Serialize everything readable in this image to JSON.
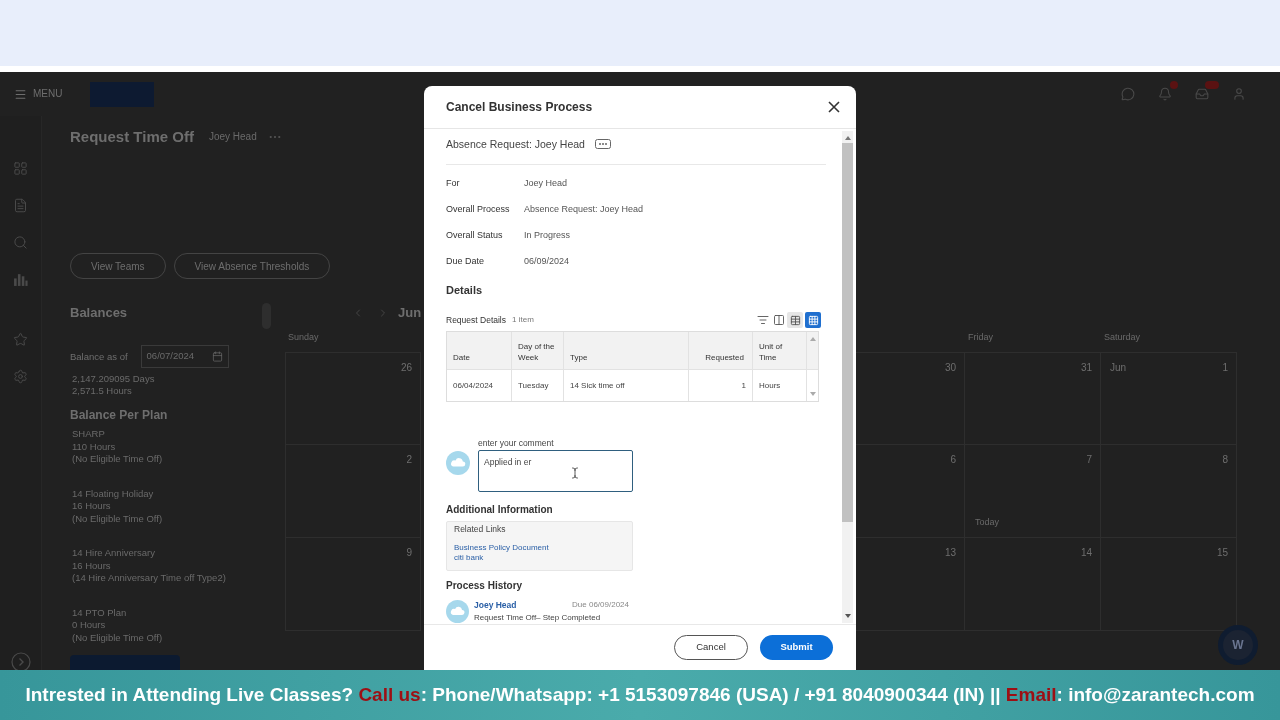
{
  "app_header": {
    "menu_label": "MENU"
  },
  "page": {
    "title": "Request Time Off",
    "worker": "Joey Head",
    "actions": [
      "View Teams",
      "View Absence Thresholds"
    ]
  },
  "balances": {
    "heading": "Balances",
    "as_of_label": "Balance as of",
    "as_of_date": "06/07/2024",
    "totals": [
      "2,147.209095 Days",
      "2,571.5 Hours"
    ],
    "per_plan_heading": "Balance Per Plan",
    "plans": [
      {
        "name": "SHARP",
        "balance": "110 Hours",
        "note": "(No Eligible Time Off)"
      },
      {
        "name": "14 Floating Holiday",
        "balance": "16 Hours",
        "note": "(No Eligible Time Off)"
      },
      {
        "name": "14 Hire Anniversary",
        "balance": "16 Hours",
        "note": "(14 Hire Anniversary Time off Type2)"
      },
      {
        "name": "14 PTO Plan",
        "balance": "0 Hours",
        "note": "(No Eligible Time Off)"
      }
    ]
  },
  "calendar": {
    "month": "Jun",
    "columns": [
      {
        "heading": "Sunday",
        "cells": [
          {
            "date": "26"
          },
          {
            "date": "2"
          },
          {
            "date": "9"
          }
        ]
      },
      {
        "cells": [
          {
            "date": "30"
          },
          {
            "date": "6"
          },
          {
            "date": "13"
          }
        ]
      },
      {
        "heading": "Friday",
        "cells": [
          {
            "date": "31"
          },
          {
            "date": "7",
            "note": "Today"
          },
          {
            "date": "14"
          }
        ]
      },
      {
        "heading": "Saturday",
        "cells": [
          {
            "date": "1",
            "month": "Jun"
          },
          {
            "date": "8"
          },
          {
            "date": "15"
          }
        ]
      }
    ]
  },
  "assistant_button": {
    "label": "W"
  },
  "dialog": {
    "title": "Cancel Business Process",
    "subject": "Absence Request: Joey Head",
    "fields": [
      {
        "label": "For",
        "value": "Joey Head"
      },
      {
        "label": "Overall Process",
        "value": "Absence Request: Joey Head"
      },
      {
        "label": "Overall Status",
        "value": "In Progress"
      },
      {
        "label": "Due Date",
        "value": "06/09/2024"
      }
    ],
    "details_heading": "Details",
    "request_details": {
      "title": "Request Details",
      "count": "1 item",
      "view_modes": [
        {
          "kind": "table",
          "selected": false
        },
        {
          "kind": "grid",
          "selected": true
        }
      ],
      "columns": [
        {
          "label": "Date",
          "kind": "text"
        },
        {
          "label": "Day of the Week",
          "kind": "text"
        },
        {
          "label": "Type",
          "kind": "text"
        },
        {
          "label": "Requested",
          "kind": "number"
        },
        {
          "label": "Unit of Time",
          "kind": "text"
        }
      ],
      "rows": [
        [
          "06/04/2024",
          "Tuesday",
          "14 Sick time off",
          "1",
          "Hours"
        ]
      ]
    },
    "comment": {
      "label": "enter your comment",
      "value": "Applied in er"
    },
    "additional_information": {
      "heading": "Additional Information",
      "related_links_heading": "Related Links",
      "links": [
        "Business Policy Document",
        "citi bank"
      ]
    },
    "process_history": {
      "heading": "Process History",
      "entries": [
        {
          "name": "Joey Head",
          "due": "Due 06/09/2024",
          "step": "Request Time Off– Step Completed"
        }
      ]
    },
    "buttons": [
      {
        "label": "Cancel",
        "kind": "secondary"
      },
      {
        "label": "Submit",
        "kind": "primary"
      }
    ]
  },
  "banner": {
    "segments": [
      {
        "text": "Intrested in Attending Live Classes? ",
        "kind": "plain"
      },
      {
        "text": "Call us",
        "kind": "highlight"
      },
      {
        "text": ": Phone/Whatsapp: +1 5153097846 (USA) / +91 8040900344 (IN) || ",
        "kind": "plain"
      },
      {
        "text": "Email",
        "kind": "highlight"
      },
      {
        "text": ": info@zarantech.com",
        "kind": "plain"
      }
    ]
  }
}
